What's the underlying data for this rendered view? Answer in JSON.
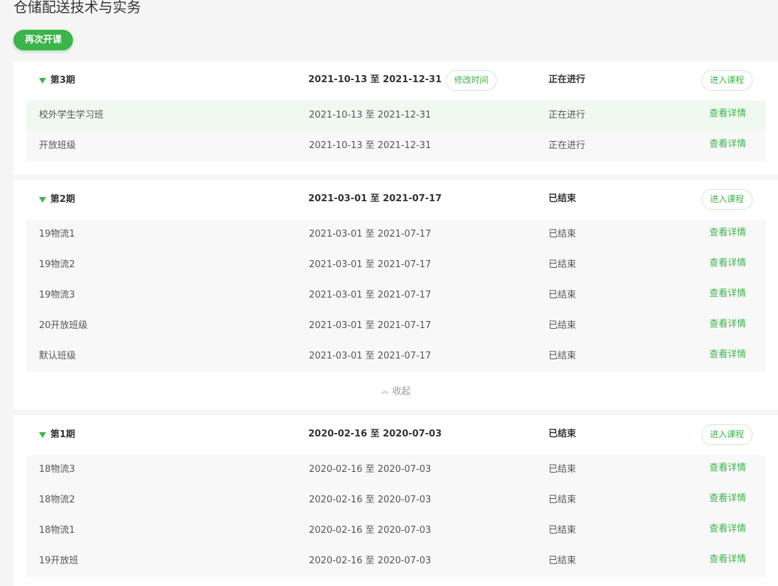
{
  "course": {
    "title": "仓储配送技术与实务",
    "reopen_label": "再次开课"
  },
  "periods": [
    {
      "name": "第3期",
      "dates": "2021-10-13 至 2021-12-31",
      "modify_label": "修改时间",
      "status": "正在进行",
      "enter_label": "进入课程",
      "classes": [
        {
          "name": "校外学生学习班",
          "dates": "2021-10-13 至 2021-12-31",
          "status": "正在进行",
          "detail_label": "查看详情"
        },
        {
          "name": "开放班级",
          "dates": "2021-10-13 至 2021-12-31",
          "status": "正在进行",
          "detail_label": "查看详情"
        }
      ]
    },
    {
      "name": "第2期",
      "dates": "2021-03-01 至 2021-07-17",
      "status": "已结束",
      "enter_label": "进入课程",
      "classes": [
        {
          "name": "19物流1",
          "dates": "2021-03-01 至 2021-07-17",
          "status": "已结束",
          "detail_label": "查看详情"
        },
        {
          "name": "19物流2",
          "dates": "2021-03-01 至 2021-07-17",
          "status": "已结束",
          "detail_label": "查看详情"
        },
        {
          "name": "19物流3",
          "dates": "2021-03-01 至 2021-07-17",
          "status": "已结束",
          "detail_label": "查看详情"
        },
        {
          "name": "20开放班级",
          "dates": "2021-03-01 至 2021-07-17",
          "status": "已结束",
          "detail_label": "查看详情"
        },
        {
          "name": "默认班级",
          "dates": "2021-03-01 至 2021-07-17",
          "status": "已结束",
          "detail_label": "查看详情"
        }
      ],
      "collapse_label": "收起"
    },
    {
      "name": "第1期",
      "dates": "2020-02-16 至 2020-07-03",
      "status": "已结束",
      "enter_label": "进入课程",
      "classes": [
        {
          "name": "18物流3",
          "dates": "2020-02-16 至 2020-07-03",
          "status": "已结束",
          "detail_label": "查看详情"
        },
        {
          "name": "18物流2",
          "dates": "2020-02-16 至 2020-07-03",
          "status": "已结束",
          "detail_label": "查看详情"
        },
        {
          "name": "18物流1",
          "dates": "2020-02-16 至 2020-07-03",
          "status": "已结束",
          "detail_label": "查看详情"
        },
        {
          "name": "19开放班",
          "dates": "2020-02-16 至 2020-07-03",
          "status": "已结束",
          "detail_label": "查看详情"
        }
      ]
    }
  ],
  "colors": {
    "accent": "#3bb44a",
    "active_row": "#f0f9f0",
    "row": "#f8f8f8",
    "page_bg": "#f5f5f5"
  }
}
